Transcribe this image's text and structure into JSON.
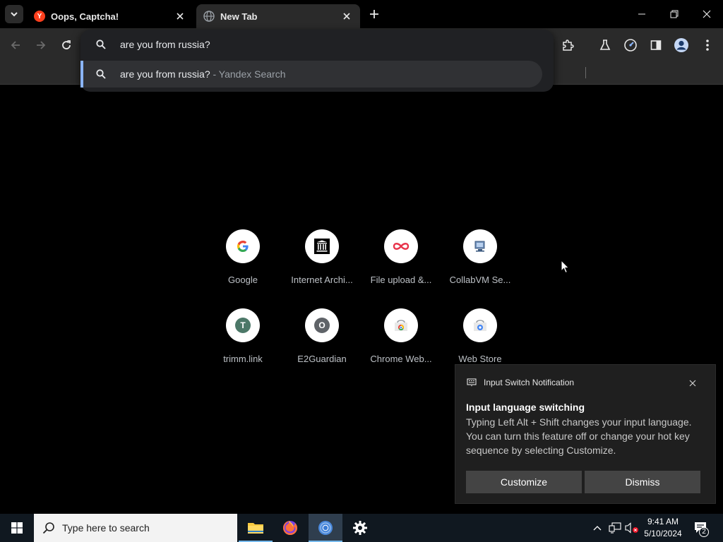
{
  "browser": {
    "tabs": [
      {
        "title": "Oops, Captcha!",
        "favicon": "yandex-y-icon",
        "active": false
      },
      {
        "title": "New Tab",
        "favicon": "globe-icon",
        "active": true
      }
    ],
    "omnibox": {
      "value": "are you from russia?",
      "suggestion": {
        "query": "are you from russia?",
        "source": " - Yandex Search"
      }
    }
  },
  "shortcuts": [
    {
      "label": "Google",
      "icon": "google-icon"
    },
    {
      "label": "Internet Archi...",
      "icon": "archive-icon"
    },
    {
      "label": "File upload &...",
      "icon": "file-upload-icon"
    },
    {
      "label": "CollabVM Se...",
      "icon": "collabvm-icon"
    },
    {
      "label": "trimm.link",
      "icon": "letter-t-icon",
      "letter": "T"
    },
    {
      "label": "E2Guardian",
      "icon": "letter-o-icon",
      "letter": "O"
    },
    {
      "label": "Chrome Web...",
      "icon": "chrome-web-store-icon"
    },
    {
      "label": "Web Store",
      "icon": "web-store-icon"
    }
  ],
  "toast": {
    "app_name": "Input Switch Notification",
    "title": "Input language switching",
    "body": "Typing Left Alt + Shift changes your input language. You can turn this feature off or change your hot key sequence by selecting Customize.",
    "buttons": {
      "customize": "Customize",
      "dismiss": "Dismiss"
    }
  },
  "taskbar": {
    "search_placeholder": "Type here to search",
    "time": "9:41 AM",
    "date": "5/10/2024",
    "notification_count": "2"
  },
  "colors": {
    "accent": "#8ab4f8",
    "yandex_red": "#fc3f1d",
    "taskbar_active": "#76b9ed"
  }
}
